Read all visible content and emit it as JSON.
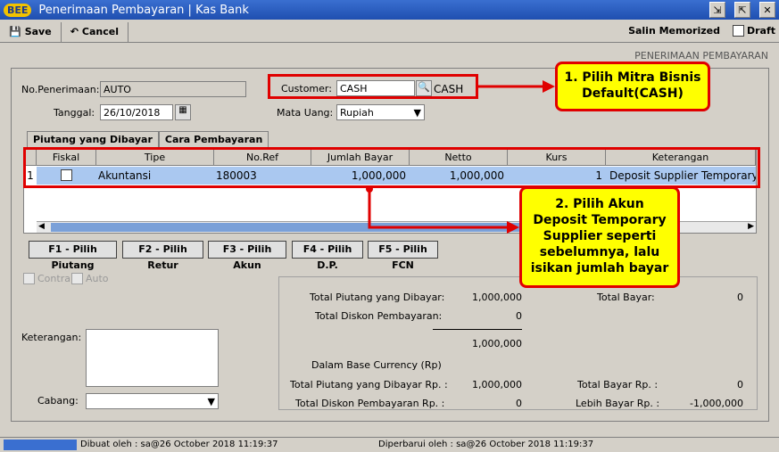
{
  "window": {
    "logo": "BEE",
    "title": "Penerimaan Pembayaran | Kas Bank"
  },
  "toolbar": {
    "save_label": "Save",
    "cancel_label": "Cancel",
    "salin_label": "Salin Memorized",
    "draft_label": "Draft"
  },
  "section_title": "PENERIMAAN PEMBAYARAN",
  "form": {
    "no_label": "No.Penerimaan:",
    "no_value": "AUTO",
    "tanggal_label": "Tanggal:",
    "tanggal_value": "26/10/2018",
    "customer_label": "Customer:",
    "customer_value": "CASH",
    "customer_name": "CASH",
    "mata_uang_label": "Mata Uang:",
    "mata_uang_value": "Rupiah"
  },
  "tabs": [
    "Piutang yang Dibayar",
    "Cara Pembayaran"
  ],
  "grid": {
    "headers": [
      "Fiskal",
      "Tipe",
      "No.Ref",
      "Jumlah Bayar",
      "Netto",
      "Kurs",
      "Keterangan"
    ],
    "rows": [
      {
        "num": "1",
        "tipe": "Akuntansi",
        "noref": "180003",
        "jumlah": "1,000,000",
        "netto": "1,000,000",
        "kurs": "1",
        "keterangan": "Deposit Supplier Temporary"
      }
    ]
  },
  "fbuttons": [
    "F1 - Pilih Piutang",
    "F2 - Pilih Retur",
    "F3 - Pilih Akun",
    "F4 - Pilih D.P.",
    "F5 - Pilih FCN"
  ],
  "options": {
    "contra": "Contra",
    "auto": "Auto"
  },
  "keterangan_label": "Keterangan:",
  "cabang_label": "Cabang:",
  "summary": {
    "total_piutang_label": "Total Piutang yang Dibayar:",
    "total_piutang": "1,000,000",
    "total_bayar_label": "Total Bayar:",
    "total_bayar": "0",
    "total_diskon_label": "Total Diskon Pembayaran:",
    "total_diskon": "0",
    "subtotal": "1,000,000",
    "base_label": "Dalam Base Currency (Rp)",
    "total_piutang_rp_label": "Total Piutang yang Dibayar Rp. :",
    "total_piutang_rp": "1,000,000",
    "total_bayar_rp_label": "Total Bayar Rp. :",
    "total_bayar_rp": "0",
    "total_diskon_rp_label": "Total Diskon Pembayaran Rp. :",
    "total_diskon_rp": "0",
    "lebih_bayar_label": "Lebih Bayar Rp. :",
    "lebih_bayar": "-1,000,000"
  },
  "callouts": {
    "c1": "1. Pilih Mitra Bisnis Default(CASH)",
    "c2": "2. Pilih Akun Deposit Temporary Supplier seperti sebelumnya, lalu isikan jumlah bayar"
  },
  "status": {
    "dibuat": "Dibuat oleh : sa@26 October 2018  11:19:37",
    "diperbarui": "Diperbarui oleh : sa@26 October 2018  11:19:37"
  }
}
